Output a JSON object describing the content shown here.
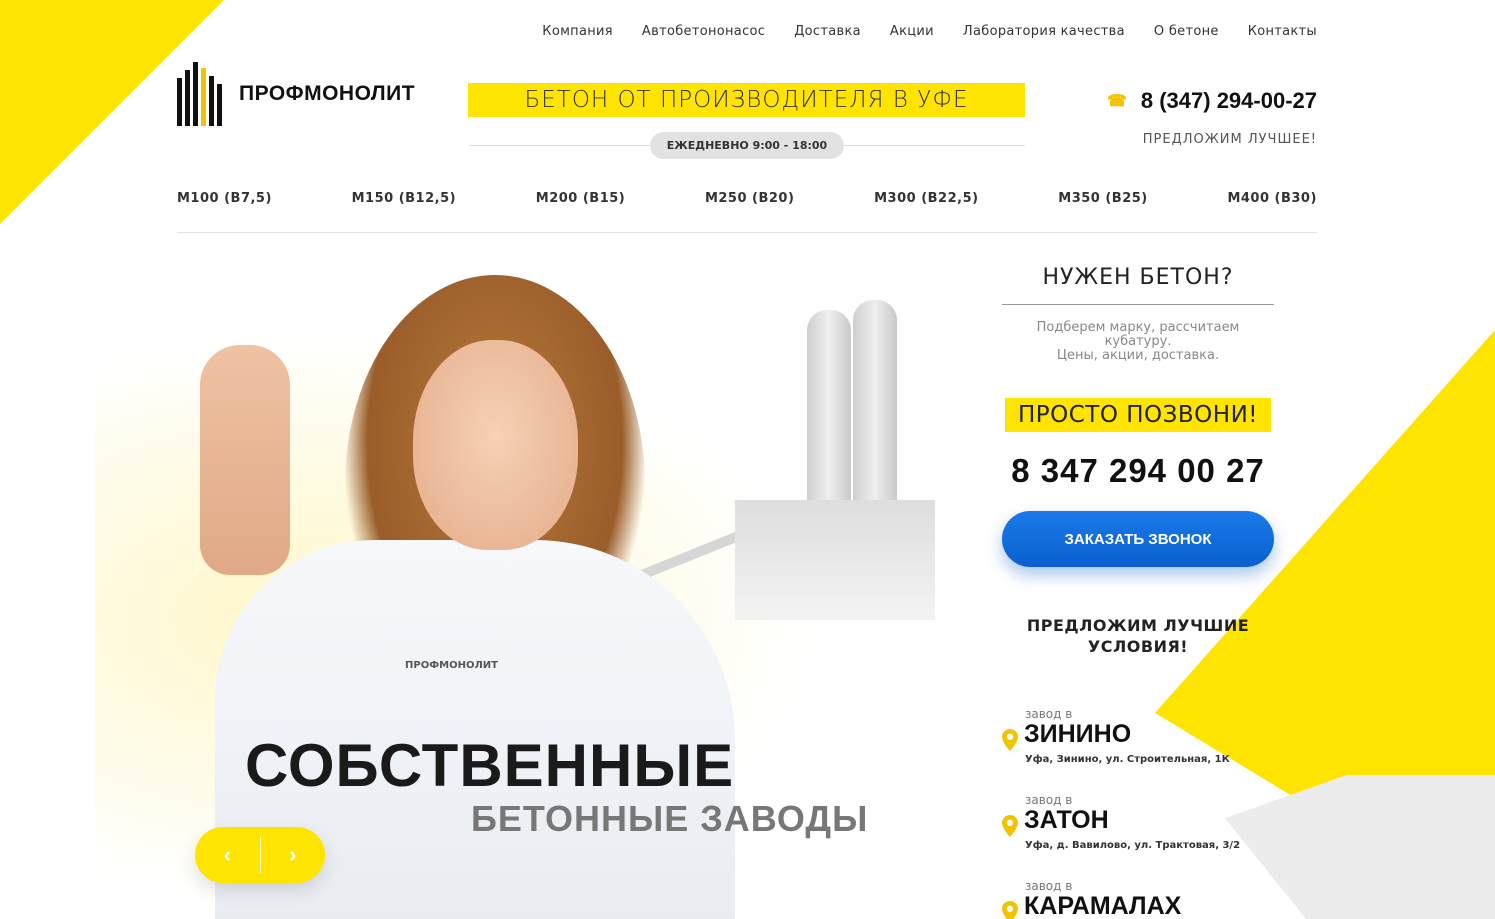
{
  "nav": [
    "Компания",
    "Автобетононасос",
    "Доставка",
    "Акции",
    "Лаборатория качества",
    "О бетоне",
    "Контакты"
  ],
  "logo": {
    "text": "ПРОФМОНОЛИТ"
  },
  "banner": {
    "title": "БЕТОН ОТ ПРОИЗВОДИТЕЛЯ В УФЕ",
    "hours": "ЕЖЕДНЕВНО 9:00 - 18:00"
  },
  "contact": {
    "phone": "8 (347) 294-00-27",
    "tagline": "ПРЕДЛОЖИМ ЛУЧШЕЕ!"
  },
  "grades": [
    "М100 (B7,5)",
    "М150 (B12,5)",
    "М200 (B15)",
    "М250 (B20)",
    "М300 (B22,5)",
    "М350 (B25)",
    "М400 (B30)"
  ],
  "hero": {
    "title": "СОБСТВЕННЫЕ",
    "subtitle": "БЕТОННЫЕ ЗАВОДЫ",
    "shirt_logo": "ПРОФМОНОЛИТ",
    "prev": "‹",
    "next": "›"
  },
  "side": {
    "question": "НУЖЕН БЕТОН?",
    "desc_line1": "Подберем марку, рассчитаем кубатуру.",
    "desc_line2": "Цены, акции, доставка.",
    "call": "ПРОСТО ПОЗВОНИ!",
    "phone": "8 347 294 00 27",
    "order_button": "ЗАКАЗАТЬ ЗВОНОК",
    "best_line1": "ПРЕДЛОЖИМ ЛУЧШИЕ",
    "best_line2": "УСЛОВИЯ!"
  },
  "plants": [
    {
      "pre": "завод в",
      "name": "ЗИНИНО",
      "addr": "Уфа, Зинино, ул. Строительная, 1К"
    },
    {
      "pre": "завод в",
      "name": "ЗАТОН",
      "addr": "Уфа, д. Вавилово, ул. Трактовая, 3/2"
    },
    {
      "pre": "завод в",
      "name": "КАРАМАЛАХ",
      "addr": ""
    }
  ],
  "colors": {
    "accent": "#ffe400",
    "button": "#0b5fcf",
    "pin": "#f4c300"
  }
}
